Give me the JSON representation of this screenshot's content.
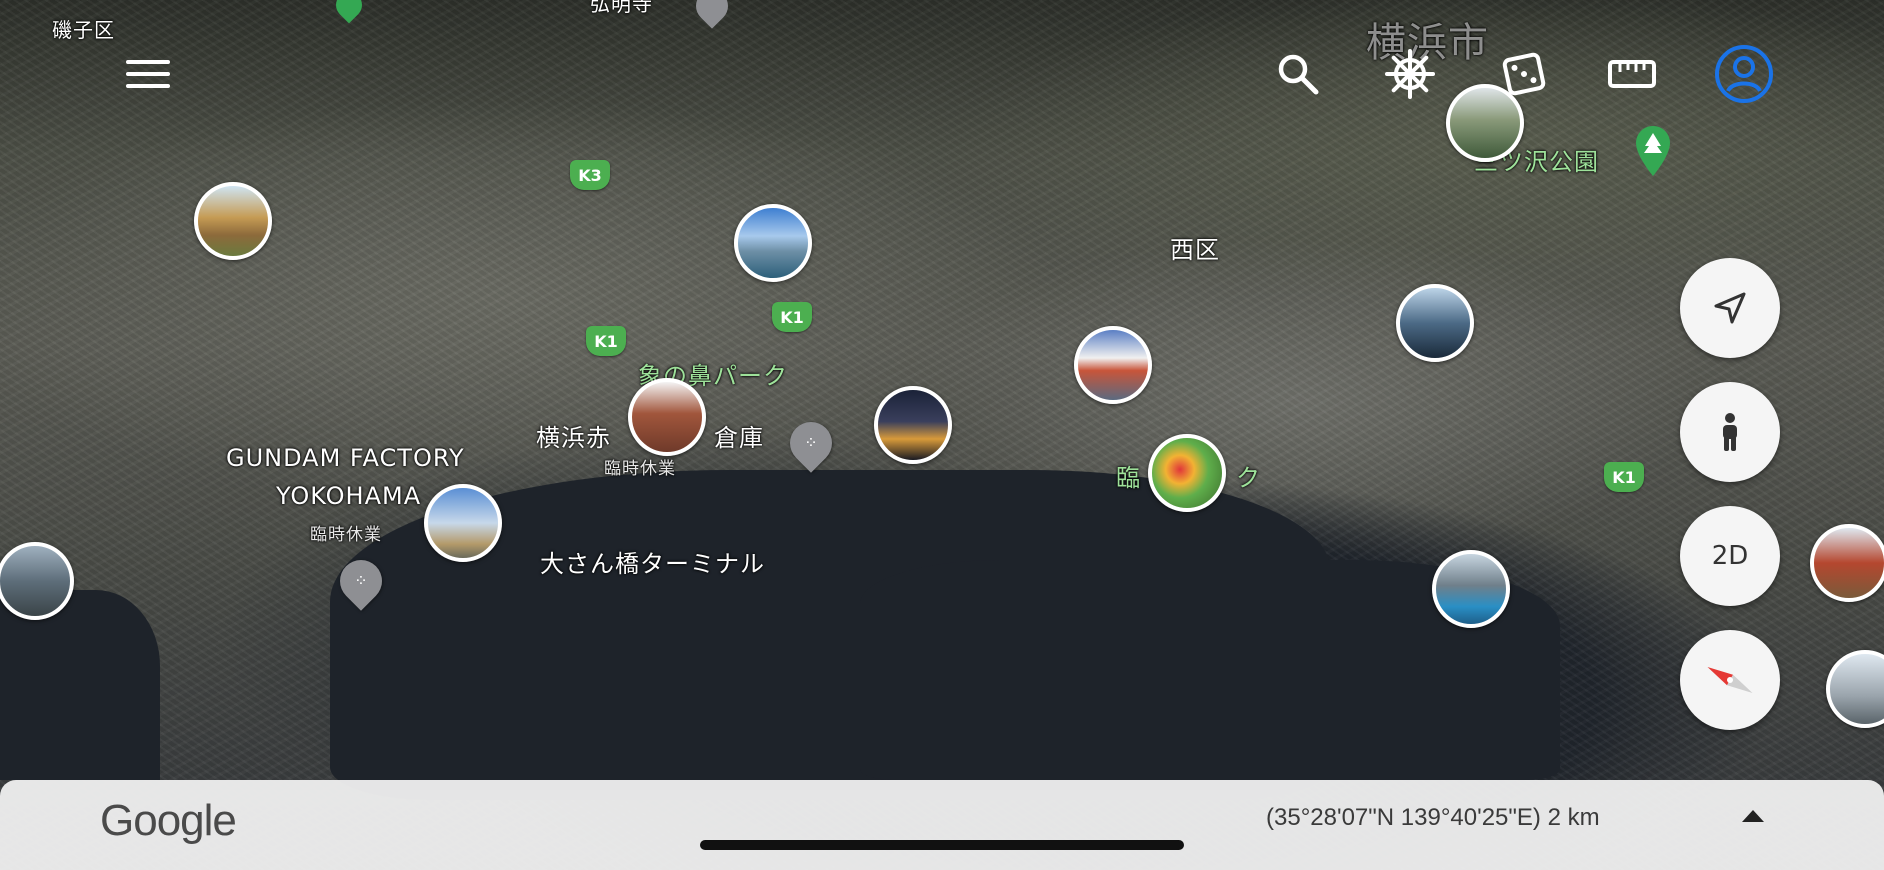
{
  "map_labels": {
    "isogo": "磯子区",
    "yokohama_city": "横浜市",
    "mitsuzawa": "三ツ沢公園",
    "nishi": "西区",
    "zou_no_hana": "象の鼻パーク",
    "red_brick_left": "横浜赤",
    "red_brick_right": "倉庫",
    "red_brick_closed": "臨時休業",
    "gundam_line1": "GUNDAM FACTORY",
    "gundam_line2": "YOKOHAMA",
    "gundam_closed": "臨時休業",
    "osanbashi": "大さん橋ターミナル",
    "rinko_left": "臨",
    "rinko_right": "ク",
    "top_partial": "弘明寺"
  },
  "road_shields": {
    "k3": "K3",
    "k1_a": "K1",
    "k1_b": "K1",
    "k1_c": "K1"
  },
  "controls": {
    "mode_2d": "2D"
  },
  "bottom_bar": {
    "logo": "Google",
    "coordinates": "(35°28'07\"N 139°40'25\"E) 2 km"
  },
  "colors": {
    "accent_blue": "#1a73e8",
    "road_green": "#4caf50",
    "park_label": "#9ee29a",
    "compass_red": "#e53935"
  }
}
